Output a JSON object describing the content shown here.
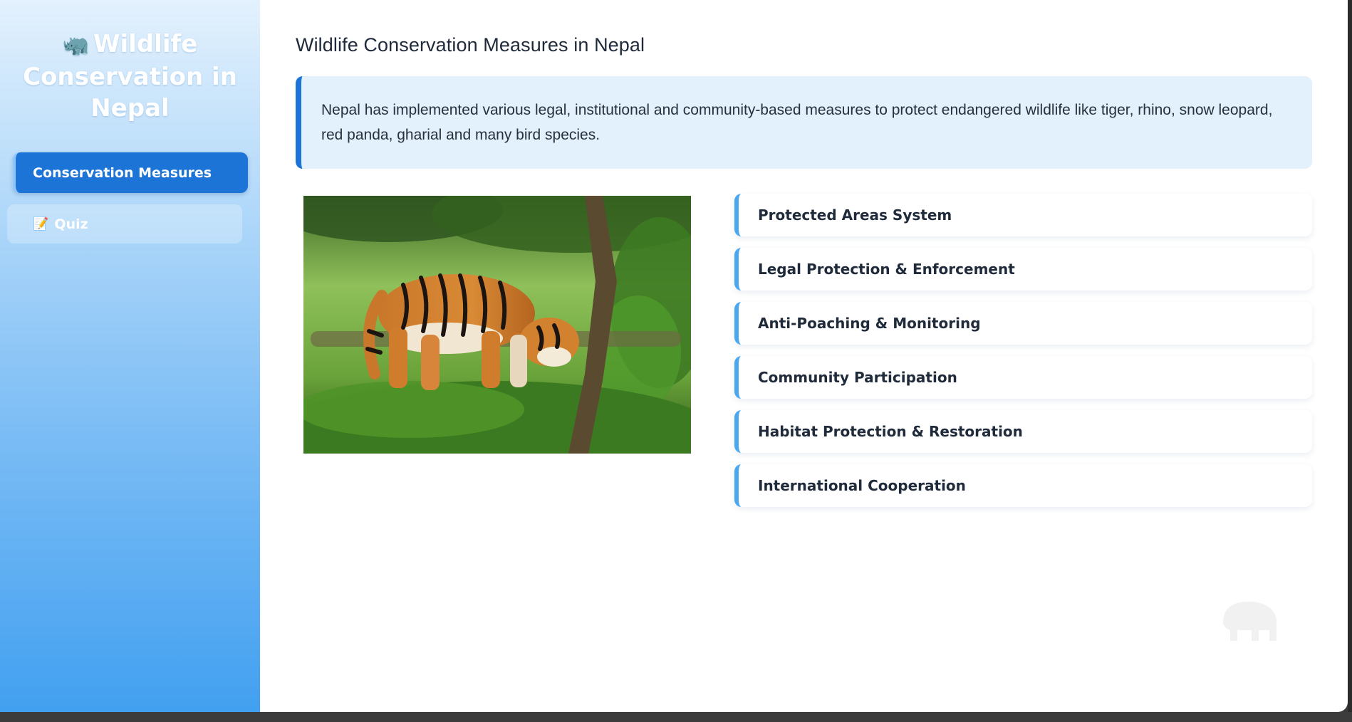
{
  "sidebar": {
    "brand_icon": "rhino-icon",
    "brand_title": "Wildlife Conservation in Nepal",
    "items": [
      {
        "label": "Conservation Measures",
        "icon": null,
        "active": true
      },
      {
        "label": "Quiz",
        "icon": "pencil-icon",
        "active": false
      }
    ]
  },
  "main": {
    "title": "Wildlife Conservation Measures in Nepal",
    "intro": "Nepal has implemented various legal, institutional and community-based measures to protect endangered wildlife like tiger, rhino, snow leopard, red panda, gharial and many bird species.",
    "measures": [
      "Protected Areas System",
      "Legal Protection & Enforcement",
      "Anti-Poaching & Monitoring",
      "Community Participation",
      "Habitat Protection & Restoration",
      "International Cooperation"
    ]
  },
  "colors": {
    "accent": "#1b74d6",
    "accent_light": "#4aa6ee",
    "intro_bg": "#e3f1fc"
  }
}
